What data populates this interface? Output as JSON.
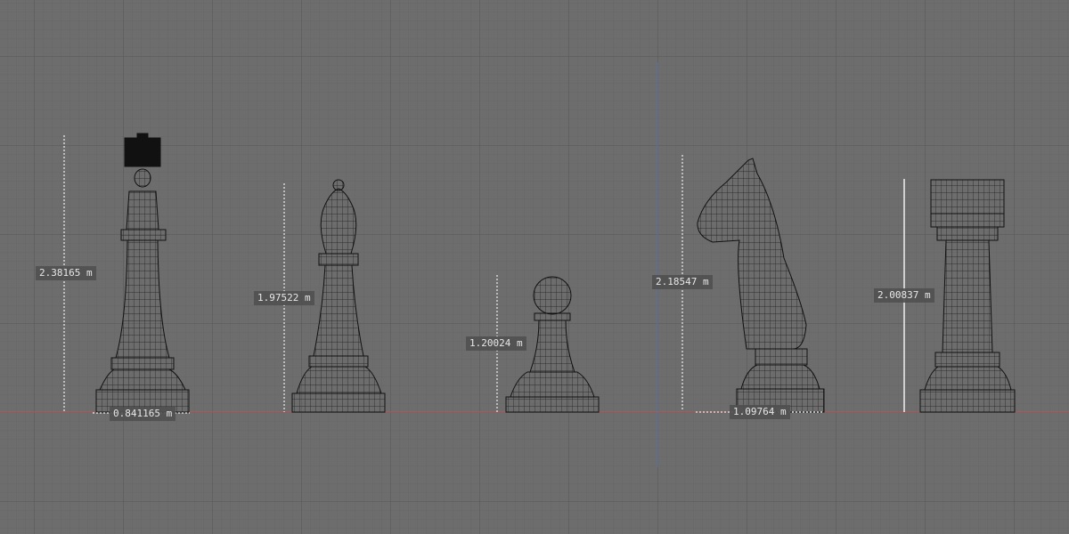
{
  "viewport": {
    "axis_colors": {
      "x_axis": "#c05050",
      "y_axis": "#5070b0"
    },
    "wire_color": "#111111"
  },
  "pieces": [
    {
      "name": "king",
      "height_label": "2.38165 m",
      "width_label": "0.841165 m"
    },
    {
      "name": "bishop",
      "height_label": "1.97522 m"
    },
    {
      "name": "pawn",
      "height_label": "1.20024 m"
    },
    {
      "name": "knight",
      "height_label": "2.18547 m",
      "width_label": "1.09764 m"
    },
    {
      "name": "rook",
      "height_label": "2.00837 m"
    }
  ]
}
